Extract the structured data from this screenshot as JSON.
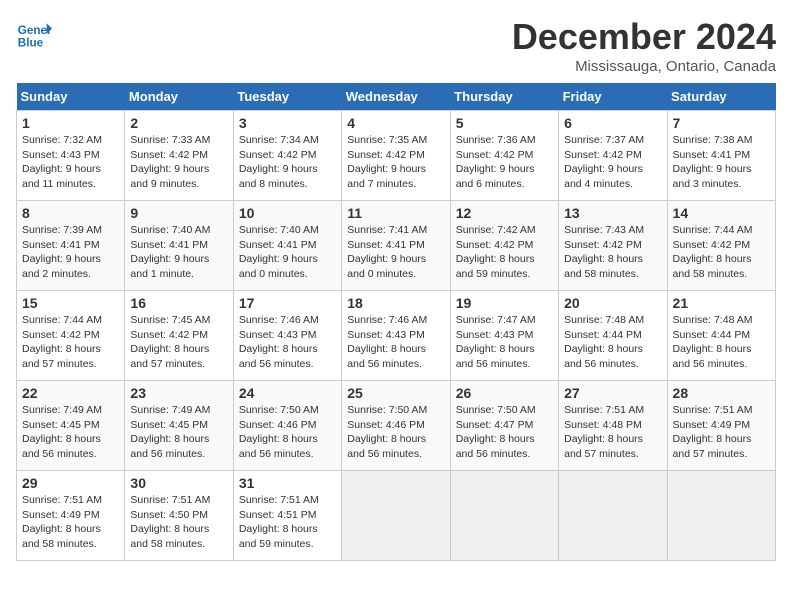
{
  "header": {
    "logo_line1": "General",
    "logo_line2": "Blue",
    "month": "December 2024",
    "location": "Mississauga, Ontario, Canada"
  },
  "weekdays": [
    "Sunday",
    "Monday",
    "Tuesday",
    "Wednesday",
    "Thursday",
    "Friday",
    "Saturday"
  ],
  "weeks": [
    [
      {
        "day": "1",
        "rise": "7:32 AM",
        "set": "4:43 PM",
        "daylight": "9 hours and 11 minutes."
      },
      {
        "day": "2",
        "rise": "7:33 AM",
        "set": "4:42 PM",
        "daylight": "9 hours and 9 minutes."
      },
      {
        "day": "3",
        "rise": "7:34 AM",
        "set": "4:42 PM",
        "daylight": "9 hours and 8 minutes."
      },
      {
        "day": "4",
        "rise": "7:35 AM",
        "set": "4:42 PM",
        "daylight": "9 hours and 7 minutes."
      },
      {
        "day": "5",
        "rise": "7:36 AM",
        "set": "4:42 PM",
        "daylight": "9 hours and 6 minutes."
      },
      {
        "day": "6",
        "rise": "7:37 AM",
        "set": "4:42 PM",
        "daylight": "9 hours and 4 minutes."
      },
      {
        "day": "7",
        "rise": "7:38 AM",
        "set": "4:41 PM",
        "daylight": "9 hours and 3 minutes."
      }
    ],
    [
      {
        "day": "8",
        "rise": "7:39 AM",
        "set": "4:41 PM",
        "daylight": "9 hours and 2 minutes."
      },
      {
        "day": "9",
        "rise": "7:40 AM",
        "set": "4:41 PM",
        "daylight": "9 hours and 1 minute."
      },
      {
        "day": "10",
        "rise": "7:40 AM",
        "set": "4:41 PM",
        "daylight": "9 hours and 0 minutes."
      },
      {
        "day": "11",
        "rise": "7:41 AM",
        "set": "4:41 PM",
        "daylight": "9 hours and 0 minutes."
      },
      {
        "day": "12",
        "rise": "7:42 AM",
        "set": "4:42 PM",
        "daylight": "8 hours and 59 minutes."
      },
      {
        "day": "13",
        "rise": "7:43 AM",
        "set": "4:42 PM",
        "daylight": "8 hours and 58 minutes."
      },
      {
        "day": "14",
        "rise": "7:44 AM",
        "set": "4:42 PM",
        "daylight": "8 hours and 58 minutes."
      }
    ],
    [
      {
        "day": "15",
        "rise": "7:44 AM",
        "set": "4:42 PM",
        "daylight": "8 hours and 57 minutes."
      },
      {
        "day": "16",
        "rise": "7:45 AM",
        "set": "4:42 PM",
        "daylight": "8 hours and 57 minutes."
      },
      {
        "day": "17",
        "rise": "7:46 AM",
        "set": "4:43 PM",
        "daylight": "8 hours and 56 minutes."
      },
      {
        "day": "18",
        "rise": "7:46 AM",
        "set": "4:43 PM",
        "daylight": "8 hours and 56 minutes."
      },
      {
        "day": "19",
        "rise": "7:47 AM",
        "set": "4:43 PM",
        "daylight": "8 hours and 56 minutes."
      },
      {
        "day": "20",
        "rise": "7:48 AM",
        "set": "4:44 PM",
        "daylight": "8 hours and 56 minutes."
      },
      {
        "day": "21",
        "rise": "7:48 AM",
        "set": "4:44 PM",
        "daylight": "8 hours and 56 minutes."
      }
    ],
    [
      {
        "day": "22",
        "rise": "7:49 AM",
        "set": "4:45 PM",
        "daylight": "8 hours and 56 minutes."
      },
      {
        "day": "23",
        "rise": "7:49 AM",
        "set": "4:45 PM",
        "daylight": "8 hours and 56 minutes."
      },
      {
        "day": "24",
        "rise": "7:50 AM",
        "set": "4:46 PM",
        "daylight": "8 hours and 56 minutes."
      },
      {
        "day": "25",
        "rise": "7:50 AM",
        "set": "4:46 PM",
        "daylight": "8 hours and 56 minutes."
      },
      {
        "day": "26",
        "rise": "7:50 AM",
        "set": "4:47 PM",
        "daylight": "8 hours and 56 minutes."
      },
      {
        "day": "27",
        "rise": "7:51 AM",
        "set": "4:48 PM",
        "daylight": "8 hours and 57 minutes."
      },
      {
        "day": "28",
        "rise": "7:51 AM",
        "set": "4:49 PM",
        "daylight": "8 hours and 57 minutes."
      }
    ],
    [
      {
        "day": "29",
        "rise": "7:51 AM",
        "set": "4:49 PM",
        "daylight": "8 hours and 58 minutes."
      },
      {
        "day": "30",
        "rise": "7:51 AM",
        "set": "4:50 PM",
        "daylight": "8 hours and 58 minutes."
      },
      {
        "day": "31",
        "rise": "7:51 AM",
        "set": "4:51 PM",
        "daylight": "8 hours and 59 minutes."
      },
      null,
      null,
      null,
      null
    ]
  ]
}
